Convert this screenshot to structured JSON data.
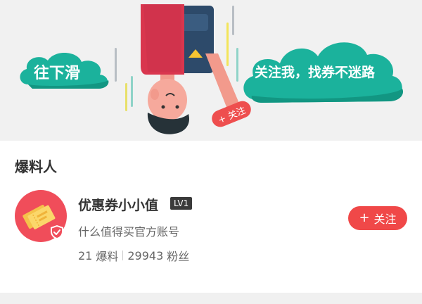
{
  "banner": {
    "left_cloud_text": "往下滑",
    "right_cloud_text": "关注我，找券不迷路",
    "tag_text": "+ 关注",
    "colors": {
      "cloud": "#1bb29c",
      "cloud_dark": "#129682",
      "tag": "#ee4e4e"
    }
  },
  "author_section": {
    "title": "爆料人",
    "name": "优惠券小小值",
    "level": "LV1",
    "description": "什么值得买官方账号",
    "posts_count": "21",
    "posts_label": "爆料",
    "fans_count": "29943",
    "fans_label": "粉丝",
    "follow_label": "关注",
    "follow_plus": "+",
    "avatar_icon": "coupon-tickets-icon",
    "verified_icon": "verified-shield-icon",
    "colors": {
      "avatar_bg": "#f04d5a",
      "follow_button": "#f04848"
    }
  }
}
